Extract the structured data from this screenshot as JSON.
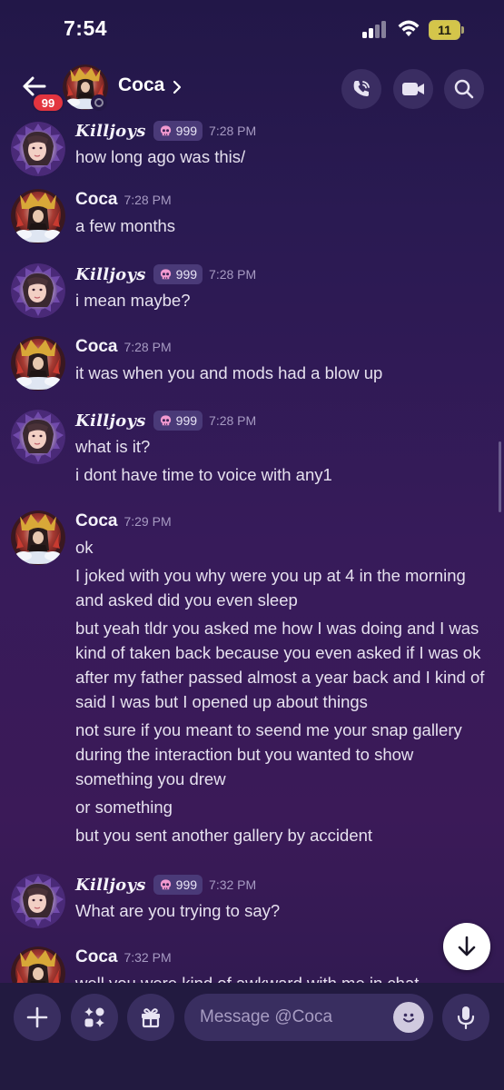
{
  "status_bar": {
    "time": "7:54",
    "battery": "11"
  },
  "header": {
    "unread_count": "99",
    "contact_name": "Coca"
  },
  "messages": [
    {
      "author": "Killjoys",
      "badge": "999",
      "time": "7:28 PM",
      "lines": [
        "how long ago was this/"
      ]
    },
    {
      "author": "Coca",
      "time": "7:28 PM",
      "lines": [
        "a few months"
      ]
    },
    {
      "author": "Killjoys",
      "badge": "999",
      "time": "7:28 PM",
      "lines": [
        "i mean maybe?"
      ]
    },
    {
      "author": "Coca",
      "time": "7:28 PM",
      "lines": [
        "it was when you and mods had a blow up"
      ]
    },
    {
      "author": "Killjoys",
      "badge": "999",
      "time": "7:28 PM",
      "lines": [
        "what is it?",
        "i dont have time to voice with any1"
      ]
    },
    {
      "author": "Coca",
      "time": "7:29 PM",
      "lines": [
        "ok",
        "I joked with you why were you up at 4 in the morning and asked did you even sleep",
        "but yeah tldr you asked me how I was doing and I was kind of taken back because you even asked if I was ok after my father passed almost a year back and I kind of said I was but I opened up about things",
        "not sure if you meant to seend me your snap gallery during the interaction but you wanted to show something you drew",
        "or something",
        "but you sent another gallery by accident"
      ]
    },
    {
      "author": "Killjoys",
      "badge": "999",
      "time": "7:32 PM",
      "lines": [
        "What are you trying to say?"
      ]
    },
    {
      "author": "Coca",
      "time": "7:32 PM",
      "lines": [
        "well you were kind of awkward with me in chat"
      ]
    }
  ],
  "composer": {
    "placeholder": "Message @Coca"
  },
  "icons": {
    "back": "arrow-left-icon",
    "chevron": "chevron-right-icon",
    "call": "phone-call-icon",
    "video": "video-camera-icon",
    "search": "search-icon",
    "jump": "arrow-down-icon",
    "add": "plus-icon",
    "apps": "apps-sparkle-icon",
    "gift": "gift-icon",
    "emoji": "emoji-icon",
    "mic": "microphone-icon",
    "role": "skull-icon"
  },
  "colors": {
    "unread_badge": "#e3343f",
    "accent_battery": "#d4c54a",
    "role_badge": "#4a3a78"
  }
}
